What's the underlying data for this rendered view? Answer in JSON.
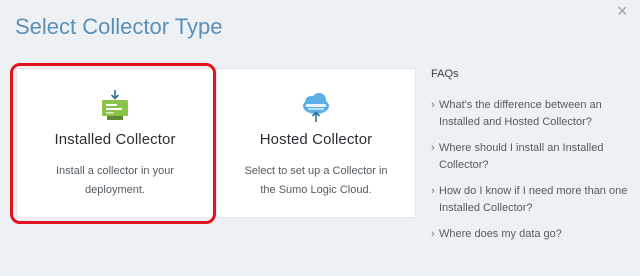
{
  "dialog": {
    "title": "Select Collector Type",
    "close_label": "×"
  },
  "cards": {
    "installed": {
      "title": "Installed Collector",
      "description": "Install a collector in your deployment.",
      "icon": "server-download-icon",
      "selected": true
    },
    "hosted": {
      "title": "Hosted Collector",
      "description": "Select to set up a Collector in the Sumo Logic Cloud.",
      "icon": "cloud-upload-icon",
      "selected": false
    }
  },
  "faqs": {
    "heading": "FAQs",
    "items": [
      {
        "chevron": "›",
        "text": "What's the difference between an Installed and Hosted Collector?"
      },
      {
        "chevron": "›",
        "text": "Where should I install an Installed Collector?"
      },
      {
        "chevron": "›",
        "text": "How do I know if I need more than one Installed Collector?"
      },
      {
        "chevron": "›",
        "text": "Where does my data go?"
      }
    ]
  },
  "colors": {
    "title": "#5b8fb7",
    "selection_border": "#e3141e",
    "installed_icon": "#8bc34a",
    "hosted_icon": "#4aa3df"
  }
}
